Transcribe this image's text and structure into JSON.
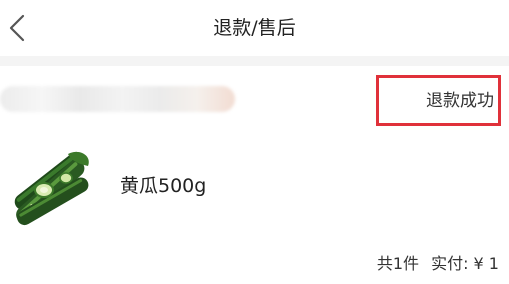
{
  "header": {
    "title": "退款/售后",
    "back_icon": "chevron-left-icon"
  },
  "order": {
    "status": "退款成功",
    "status_highlight_color": "#e0313a"
  },
  "product": {
    "name": "黄瓜500g",
    "image_icon": "cucumber-image"
  },
  "summary": {
    "count_text": "共1件",
    "paid_text": "实付: ¥ 1"
  }
}
